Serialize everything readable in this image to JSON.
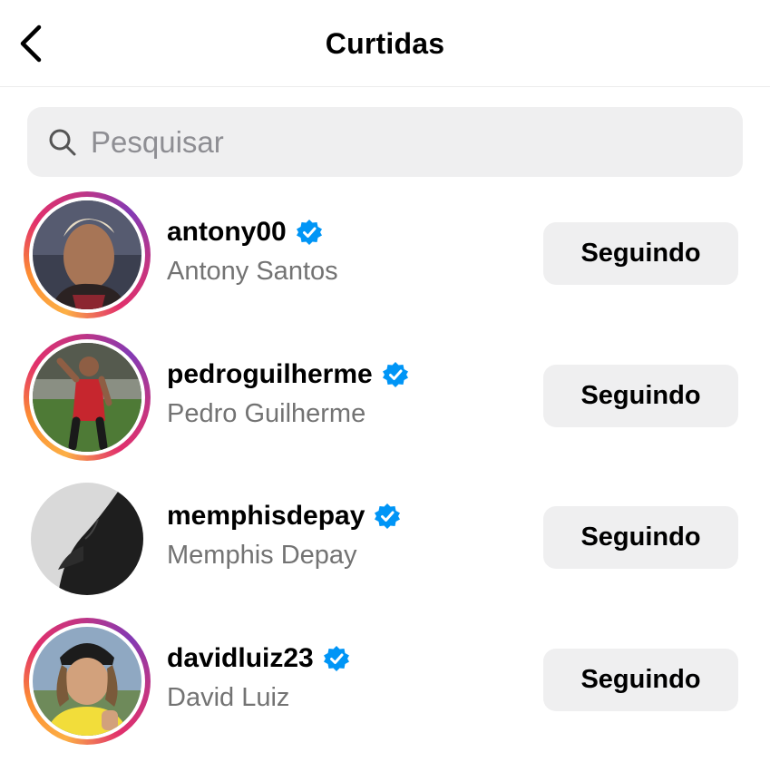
{
  "header": {
    "title": "Curtidas",
    "back_icon": "chevron-left-icon"
  },
  "search": {
    "placeholder": "Pesquisar",
    "value": "",
    "icon": "search-icon"
  },
  "colors": {
    "verified": "#0095f6",
    "button_bg": "#efeff0",
    "secondary_text": "#737373",
    "story_ring": [
      "#fcaf45",
      "#e1306c",
      "#833ab4"
    ]
  },
  "users": [
    {
      "username": "antony00",
      "full_name": "Antony Santos",
      "verified": true,
      "has_story": true,
      "button_label": "Seguindo"
    },
    {
      "username": "pedroguilherme",
      "full_name": "Pedro Guilherme",
      "verified": true,
      "has_story": true,
      "button_label": "Seguindo"
    },
    {
      "username": "memphisdepay",
      "full_name": "Memphis Depay",
      "verified": true,
      "has_story": false,
      "button_label": "Seguindo"
    },
    {
      "username": "davidluiz23",
      "full_name": "David Luiz",
      "verified": true,
      "has_story": true,
      "button_label": "Seguindo"
    }
  ]
}
